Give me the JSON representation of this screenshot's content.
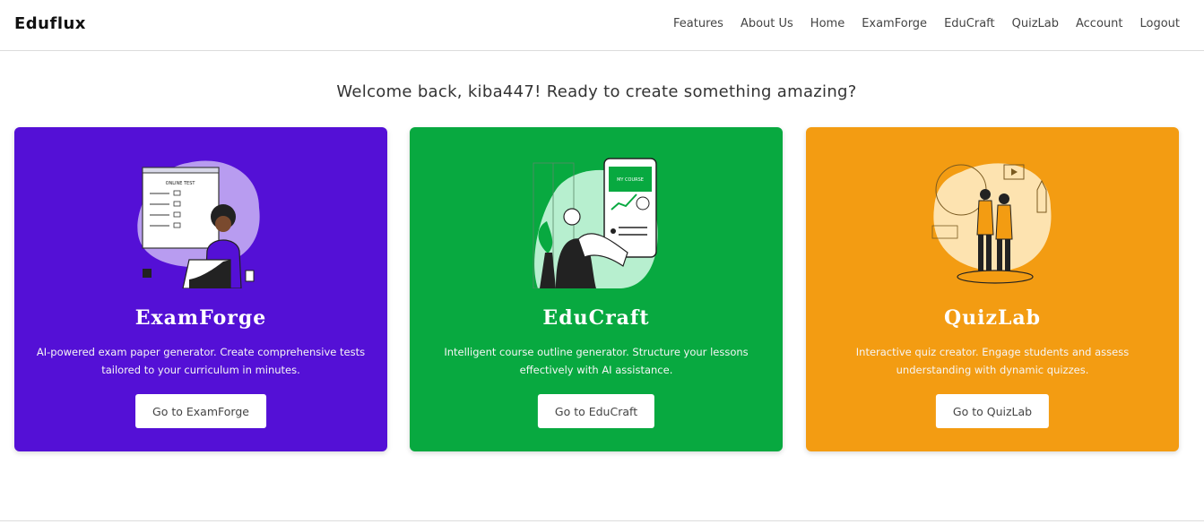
{
  "brand": "Eduflux",
  "nav": [
    "Features",
    "About Us",
    "Home",
    "ExamForge",
    "EduCraft",
    "QuizLab",
    "Account",
    "Logout"
  ],
  "welcome": "Welcome back, kiba447! Ready to create something amazing?",
  "cards": [
    {
      "title": "ExamForge",
      "description": "AI-powered exam paper generator. Create comprehensive tests tailored to your curriculum in minutes.",
      "button": "Go to ExamForge",
      "color": "#5410d6",
      "illustration_text": "ONLINE TEST",
      "icon": "online-test-illustration-icon"
    },
    {
      "title": "EduCraft",
      "description": "Intelligent course outline generator. Structure your lessons effectively with AI assistance.",
      "button": "Go to EduCraft",
      "color": "#08a940",
      "illustration_text": "MY COURSE",
      "icon": "online-course-illustration-icon"
    },
    {
      "title": "QuizLab",
      "description": "Interactive quiz creator. Engage students and assess understanding with dynamic quizzes.",
      "button": "Go to QuizLab",
      "color": "#f39c12",
      "icon": "interactive-learning-illustration-icon"
    }
  ]
}
